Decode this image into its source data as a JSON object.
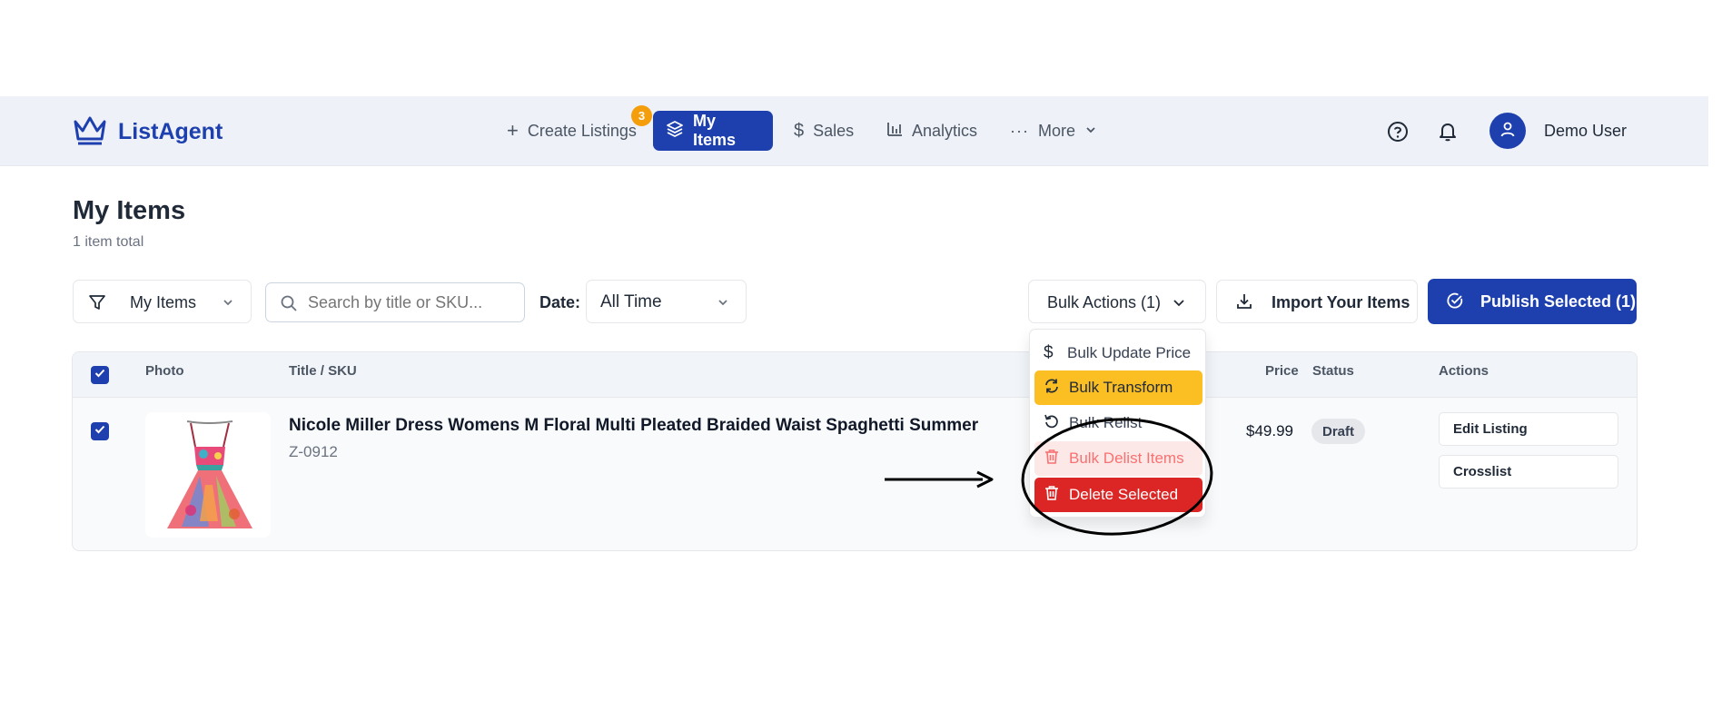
{
  "header": {
    "brand": "ListAgent",
    "nav": {
      "create_listings": "Create Listings",
      "create_badge": "3",
      "my_items": "My Items",
      "sales": "Sales",
      "analytics": "Analytics",
      "more": "More"
    },
    "user_name": "Demo User"
  },
  "page": {
    "title": "My Items",
    "subtitle": "1 item total"
  },
  "toolbar": {
    "filter_value": "My Items",
    "search_placeholder": "Search by title or SKU...",
    "date_label": "Date:",
    "date_value": "All Time",
    "bulk_actions": "Bulk Actions (1)",
    "import": "Import Your Items",
    "publish": "Publish Selected (1)"
  },
  "bulk_menu": {
    "update_price": "Bulk Update Price",
    "transform": "Bulk Transform",
    "relist": "Bulk Relist",
    "delist": "Bulk Delist Items",
    "delete": "Delete Selected"
  },
  "table": {
    "headers": {
      "photo": "Photo",
      "title_sku": "Title / SKU",
      "price": "Price",
      "status": "Status",
      "actions": "Actions"
    },
    "rows": [
      {
        "title": "Nicole Miller Dress Womens M Floral Multi Pleated Braided Waist Spaghetti Summer",
        "sku": "Z-0912",
        "price": "$49.99",
        "status": "Draft",
        "actions": [
          "Edit Listing",
          "Crosslist"
        ]
      }
    ]
  },
  "colors": {
    "brand": "#1e40af",
    "badge": "#f59e0b",
    "highlight_yellow": "#fbbf24",
    "danger": "#dc2626"
  }
}
